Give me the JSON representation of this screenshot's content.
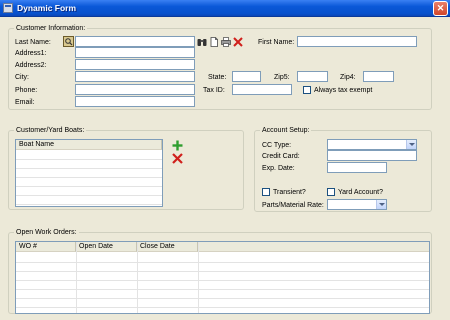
{
  "window": {
    "title": "Dynamic Form"
  },
  "customer": {
    "legend": "Customer Information:",
    "last_name_label": "Last Name:",
    "first_name_label": "First Name:",
    "address1_label": "Address1:",
    "address2_label": "Address2:",
    "city_label": "City:",
    "state_label": "State:",
    "zip5_label": "Zip5:",
    "zip4_label": "Zip4:",
    "phone_label": "Phone:",
    "tax_id_label": "Tax ID:",
    "always_tax_exempt_label": "Always tax exempt",
    "email_label": "Email:",
    "fields": {
      "last_name": "",
      "first_name": "",
      "address1": "",
      "address2": "",
      "city": "",
      "state": "",
      "zip5": "",
      "zip4": "",
      "phone": "",
      "tax_id": "",
      "email": ""
    },
    "always_tax_exempt": false
  },
  "boats": {
    "legend": "Customer/Yard Boats:",
    "column_boat_name": "Boat Name"
  },
  "account": {
    "legend": "Account Setup:",
    "cc_type_label": "CC Type:",
    "credit_card_label": "Credit Card:",
    "exp_date_label": "Exp. Date:",
    "transient_label": "Transient?",
    "yard_account_label": "Yard Account?",
    "parts_rate_label": "Parts/Material Rate:",
    "cc_type_value": "",
    "credit_card_value": "",
    "exp_date_value": "",
    "parts_rate_value": "",
    "transient": false,
    "yard_account": false
  },
  "work_orders": {
    "legend": "Open Work Orders:",
    "columns": [
      "WO #",
      "Open Date",
      "Close Date"
    ]
  },
  "icons": {
    "lookup": "lookup-icon",
    "binoculars": "binoculars-icon",
    "new": "new-document-icon",
    "print": "print-icon",
    "delete": "delete-icon",
    "add_boat": "add-icon",
    "remove_boat": "remove-icon"
  },
  "colors": {
    "titlebar": "#0a58d8",
    "window_bg": "#ece9d8",
    "field_border": "#7f9db9",
    "add_green": "#2f9e2f",
    "delete_red": "#d0201c"
  }
}
